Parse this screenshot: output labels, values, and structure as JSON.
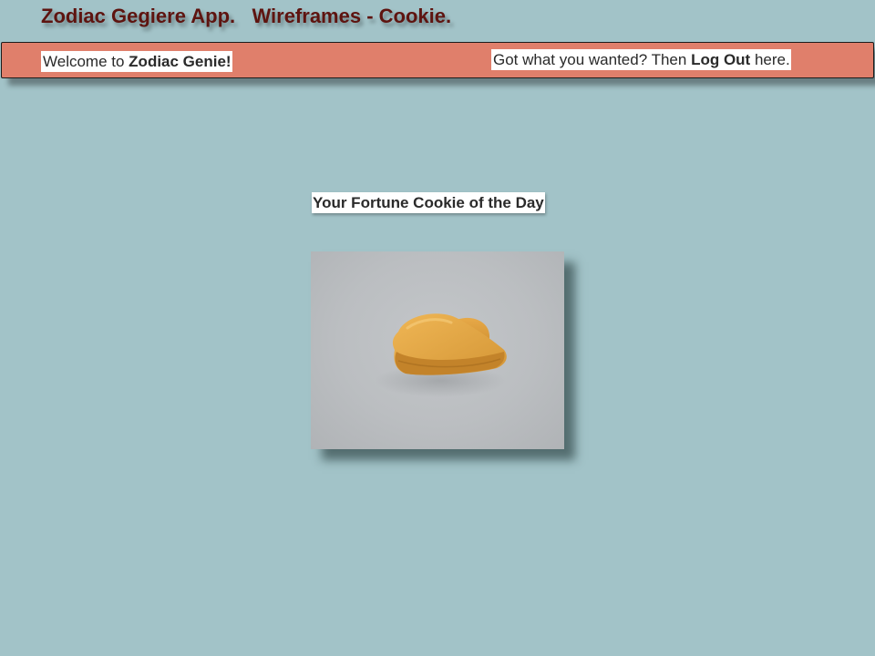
{
  "page_title": "Zodiac Gegiere App.   Wireframes - Cookie.",
  "header": {
    "welcome_prefix": "Welcome to ",
    "app_name": "Zodiac Genie!",
    "logout_prefix": "Got what you wanted?  Then ",
    "logout_link": "Log Out",
    "logout_suffix": " here."
  },
  "main": {
    "fortune_heading": "Your Fortune Cookie of the Day",
    "image_alt": "fortune-cookie-photo"
  },
  "colors": {
    "background": "#a2c3c8",
    "header_bar": "#e07f6b",
    "title_text": "#5e1410"
  }
}
